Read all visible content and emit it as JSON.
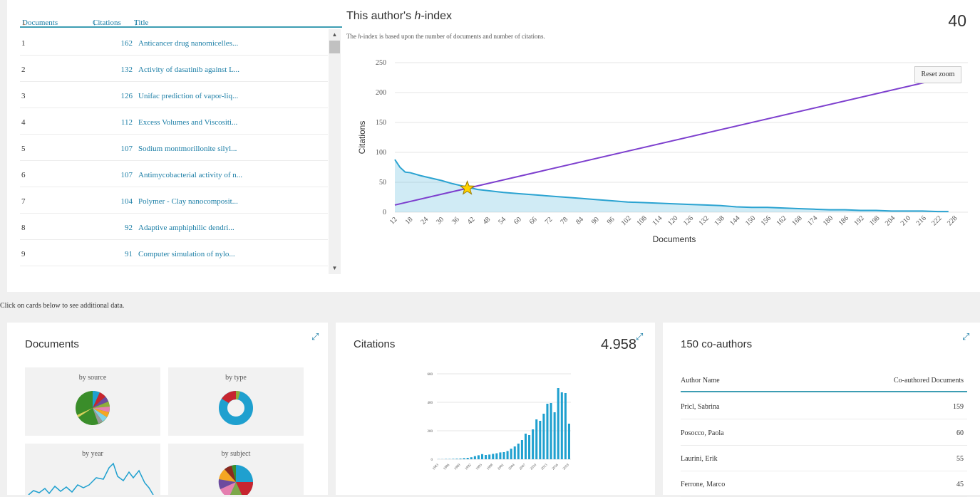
{
  "table": {
    "headers": {
      "documents": "Documents",
      "citations": "Citations",
      "title": "Title"
    },
    "rows": [
      {
        "n": "1",
        "citations": "162",
        "title": "Anticancer drug nanomicelles..."
      },
      {
        "n": "2",
        "citations": "132",
        "title": "Activity of dasatinib against L..."
      },
      {
        "n": "3",
        "citations": "126",
        "title": "Unifac prediction of vapor-liq..."
      },
      {
        "n": "4",
        "citations": "112",
        "title": "Excess Volumes and Viscositi..."
      },
      {
        "n": "5",
        "citations": "107",
        "title": "Sodium montmorillonite silyl..."
      },
      {
        "n": "6",
        "citations": "107",
        "title": "Antimycobacterial activity of n..."
      },
      {
        "n": "7",
        "citations": "104",
        "title": "Polymer - Clay nanocomposit..."
      },
      {
        "n": "8",
        "citations": "92",
        "title": "Adaptive amphiphilic dendri..."
      },
      {
        "n": "9",
        "citations": "91",
        "title": "Computer simulation of nylo..."
      }
    ]
  },
  "hindex": {
    "title_prefix": "This author's ",
    "title_h": "h",
    "title_suffix": "-index",
    "sub_h": "h",
    "subtitle_rest": "-index is based upon the number of documents and number of citations.",
    "value": "40",
    "reset_label": "Reset zoom",
    "xlabel": "Documents",
    "ylabel": "Citations",
    "line_color": "#7d3fce",
    "area_color": "#2ba3d1"
  },
  "chart_data": [
    {
      "type": "area",
      "xlabel": "Documents",
      "ylabel": "Citations",
      "ylim": [
        0,
        250
      ],
      "yticks": [
        0,
        50,
        100,
        150,
        200,
        250
      ],
      "xlim": [
        12,
        228
      ],
      "xticks": [
        12,
        18,
        24,
        30,
        36,
        42,
        48,
        54,
        60,
        66,
        72,
        78,
        84,
        90,
        96,
        102,
        108,
        114,
        120,
        126,
        132,
        138,
        144,
        150,
        156,
        162,
        168,
        174,
        180,
        186,
        192,
        198,
        204,
        210,
        216,
        222,
        228
      ],
      "series": [
        {
          "kind": "area",
          "x": [
            12,
            14,
            16,
            18,
            22,
            26,
            30,
            34,
            38,
            40,
            44,
            48,
            54,
            60,
            66,
            72,
            78,
            84,
            90,
            96,
            102,
            108,
            114,
            120,
            126,
            132,
            138,
            144,
            150,
            156,
            162,
            168,
            174,
            180,
            186,
            192,
            198,
            204,
            210,
            216,
            222,
            226
          ],
          "y": [
            88,
            75,
            67,
            66,
            61,
            57,
            53,
            48,
            44,
            42,
            38,
            36,
            33,
            31,
            29,
            27,
            25,
            23,
            21,
            19,
            17,
            16,
            15,
            14,
            13,
            12,
            11,
            9,
            8,
            8,
            7,
            6,
            5,
            4,
            4,
            3,
            3,
            2,
            2,
            2,
            1,
            1
          ]
        },
        {
          "kind": "line",
          "x": [
            12,
            226
          ],
          "y": [
            12,
            226
          ]
        }
      ],
      "marker": {
        "x": 40,
        "y": 40,
        "shape": "star"
      }
    },
    {
      "type": "bar",
      "yticks": [
        0,
        200,
        400,
        600
      ],
      "ylim": [
        0,
        600
      ],
      "xticks": [
        "1983",
        "1986",
        "1989",
        "1992",
        "1995",
        "1998",
        "2001",
        "2004",
        "2007",
        "2010",
        "2013",
        "2016",
        "2019"
      ],
      "x": [
        1983,
        1984,
        1985,
        1986,
        1987,
        1988,
        1989,
        1990,
        1991,
        1992,
        1993,
        1994,
        1995,
        1996,
        1997,
        1998,
        1999,
        2000,
        2001,
        2002,
        2003,
        2004,
        2005,
        2006,
        2007,
        2008,
        2009,
        2010,
        2011,
        2012,
        2013,
        2014,
        2015,
        2016,
        2017,
        2018,
        2019
      ],
      "values": [
        1,
        1,
        2,
        2,
        3,
        4,
        5,
        8,
        10,
        14,
        22,
        28,
        36,
        30,
        33,
        38,
        42,
        48,
        50,
        58,
        74,
        90,
        110,
        135,
        180,
        170,
        210,
        280,
        270,
        320,
        390,
        395,
        330,
        500,
        470,
        465,
        250
      ]
    }
  ],
  "band_text": "Click on cards below to see additional data.",
  "cards": {
    "documents": {
      "title": "Documents",
      "minis": [
        "by source",
        "by type",
        "by year",
        "by subject"
      ]
    },
    "citations": {
      "title": "Citations",
      "value": "4.958"
    },
    "coauthors": {
      "title": "150 co-authors",
      "col_name": "Author Name",
      "col_count": "Co-authored Documents",
      "rows": [
        {
          "name": "Pricl, Sabrina",
          "count": "159"
        },
        {
          "name": "Posocco, Paola",
          "count": "60"
        },
        {
          "name": "Laurini, Erik",
          "count": "55"
        },
        {
          "name": "Ferrone, Marco",
          "count": "45"
        }
      ]
    }
  }
}
